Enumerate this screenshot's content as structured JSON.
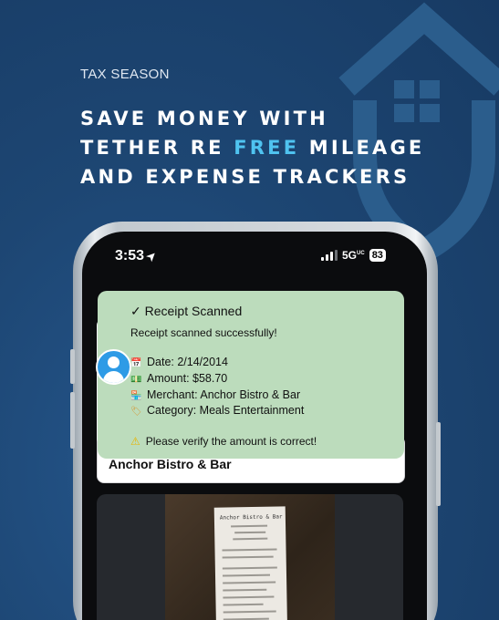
{
  "promo": {
    "eyebrow": "TAX SEASON",
    "headline_line1": "SAVE MONEY WITH",
    "headline_line2_before": "TETHER RE ",
    "headline_accent": "FREE",
    "headline_line2_after": " MILEAGE",
    "headline_line3": "AND EXPENSE TRACKERS",
    "accent_color": "#4fc3f0",
    "background_color": "#1e4670"
  },
  "status_bar": {
    "time": "3:53",
    "location_icon": "location-arrow-icon",
    "network": "5G",
    "network_suffix": "UC",
    "battery": "83"
  },
  "toast": {
    "title": "✓ Receipt Scanned",
    "message": "Receipt scanned successfully!",
    "date": "Date: 2/14/2014",
    "amount": "Amount: $58.70",
    "merchant": "Merchant: Anchor Bistro & Bar",
    "category": "Category: Meals Entertainment",
    "warning": "Please verify the amount is correct!",
    "background": "#bcdcbc"
  },
  "result_card": {
    "merchant": "Anchor Bistro & Bar"
  },
  "receipt_photo": {
    "header": "Anchor Bistro & Bar"
  }
}
